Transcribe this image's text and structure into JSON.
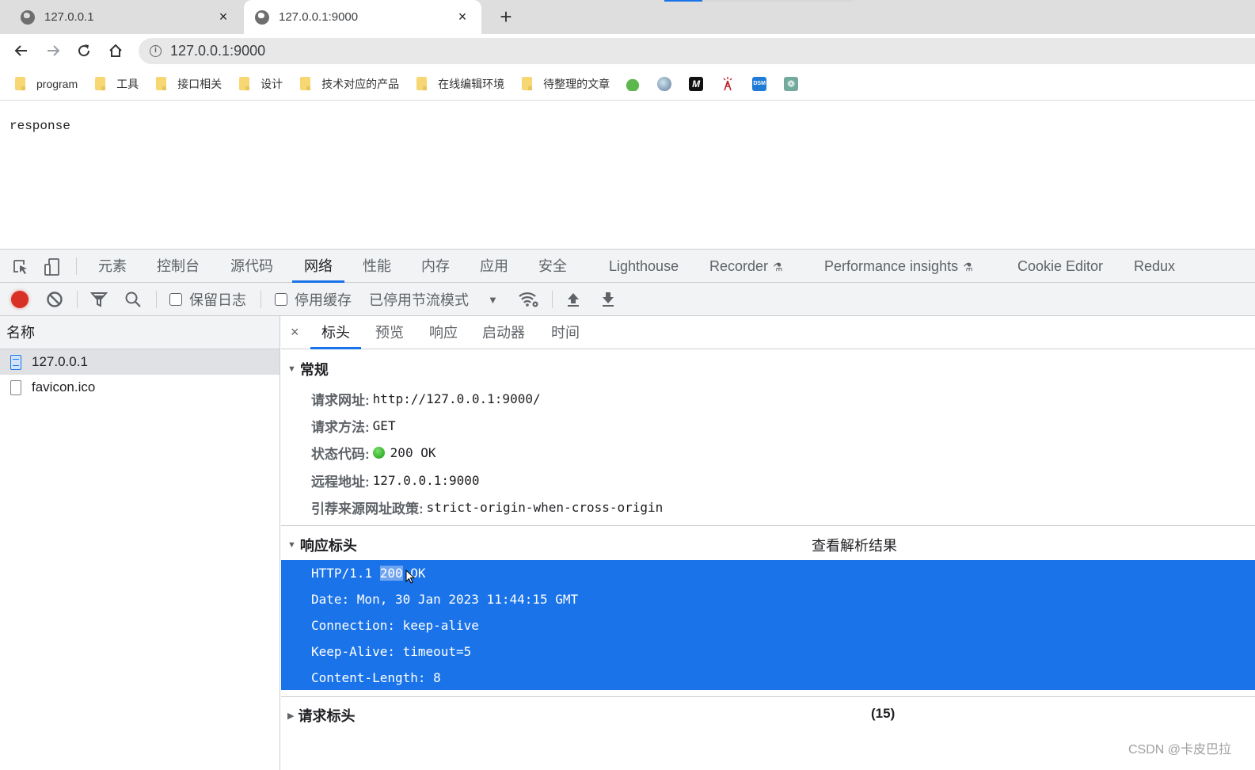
{
  "browser": {
    "tabs": [
      {
        "title": "127.0.0.1",
        "active": false
      },
      {
        "title": "127.0.0.1:9000",
        "active": true
      }
    ],
    "new_tab_label": "+",
    "close_glyph": "×",
    "address": "127.0.0.1:9000",
    "bookmarks_folders": [
      "program",
      "工具",
      "接口相关",
      "设计",
      "技术对应的产品",
      "在线编辑环境",
      "待整理的文章"
    ],
    "bookmark_icons": [
      {
        "name": "leaf-bookmark-icon",
        "glyph": ""
      },
      {
        "name": "anime-avatar-bookmark-icon",
        "glyph": ""
      },
      {
        "name": "m-logo-bookmark-icon",
        "glyph": "M"
      },
      {
        "name": "tower-bookmark-icon",
        "glyph": "⚡"
      },
      {
        "name": "dsm-bookmark-icon",
        "glyph": "DSM"
      },
      {
        "name": "chatgpt-bookmark-icon",
        "glyph": "❁"
      }
    ]
  },
  "page": {
    "body_text": "response"
  },
  "devtools": {
    "tabs": [
      {
        "label": "元素",
        "active": false
      },
      {
        "label": "控制台",
        "active": false
      },
      {
        "label": "源代码",
        "active": false
      },
      {
        "label": "网络",
        "active": true
      },
      {
        "label": "性能",
        "active": false
      },
      {
        "label": "内存",
        "active": false
      },
      {
        "label": "应用",
        "active": false
      },
      {
        "label": "安全",
        "active": false
      },
      {
        "label": "Lighthouse",
        "active": false
      },
      {
        "label": "Recorder",
        "active": false,
        "experimental": true
      },
      {
        "label": "Performance insights",
        "active": false,
        "experimental": true
      },
      {
        "label": "Cookie Editor",
        "active": false
      },
      {
        "label": "Redux",
        "active": false
      }
    ],
    "flask_glyph": "⚗",
    "network_toolbar": {
      "preserve_log_label": "保留日志",
      "preserve_log_checked": false,
      "disable_cache_label": "停用缓存",
      "disable_cache_checked": false,
      "throttling_value": "已停用节流模式"
    },
    "requests": {
      "column_header": "名称",
      "rows": [
        {
          "name": "127.0.0.1",
          "selected": true,
          "type": "document"
        },
        {
          "name": "favicon.ico",
          "selected": false,
          "type": "other"
        }
      ]
    },
    "details": {
      "close_glyph": "×",
      "tabs": [
        {
          "label": "标头",
          "active": true
        },
        {
          "label": "预览",
          "active": false
        },
        {
          "label": "响应",
          "active": false
        },
        {
          "label": "启动器",
          "active": false
        },
        {
          "label": "时间",
          "active": false
        }
      ],
      "general": {
        "title": "常规",
        "rows": [
          {
            "key": "请求网址:",
            "value": "http://127.0.0.1:9000/"
          },
          {
            "key": "请求方法:",
            "value": "GET"
          },
          {
            "key": "状态代码:",
            "value": "200 OK",
            "status_color": "#1e9e1e"
          },
          {
            "key": "远程地址:",
            "value": "127.0.0.1:9000"
          },
          {
            "key": "引荐来源网址政策:",
            "value": "strict-origin-when-cross-origin"
          }
        ]
      },
      "response_headers": {
        "title": "响应标头",
        "view_parsed_label": "查看解析结果",
        "status_line_prefix": "HTTP/1.1 ",
        "status_line_highlight": "200",
        "status_line_suffix": " OK",
        "lines": [
          "Date: Mon, 30 Jan 2023 11:44:15 GMT",
          "Connection: keep-alive",
          "Keep-Alive: timeout=5",
          "Content-Length: 8"
        ]
      },
      "request_headers": {
        "title": "请求标头",
        "count": "(15)"
      }
    }
  },
  "watermark": "CSDN @卡皮巴拉",
  "colors": {
    "accent": "#1a73e8",
    "record": "#d93025",
    "selection": "#1a73e8"
  }
}
